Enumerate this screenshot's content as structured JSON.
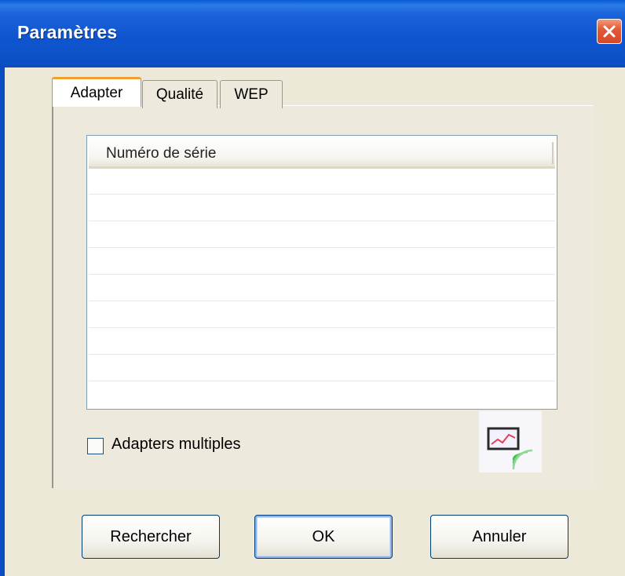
{
  "window": {
    "title": "Paramètres"
  },
  "tabs": [
    {
      "label": "Adapter",
      "active": true
    },
    {
      "label": "Qualité",
      "active": false
    },
    {
      "label": "WEP",
      "active": false
    }
  ],
  "list": {
    "columns": [
      "Numéro de série"
    ],
    "rows": []
  },
  "options": {
    "multiple_adapters_label": "Adapters multiples",
    "multiple_adapters_checked": false
  },
  "icons": {
    "close": "close-icon",
    "status": "wireless-monitor-icon"
  },
  "buttons": {
    "search": "Rechercher",
    "ok": "OK",
    "cancel": "Annuler"
  },
  "colors": {
    "titlebar": "#0d52c8",
    "close": "#d44a2a",
    "active_tab_accent": "#f0a030",
    "dialog_bg": "#ece9d8"
  }
}
